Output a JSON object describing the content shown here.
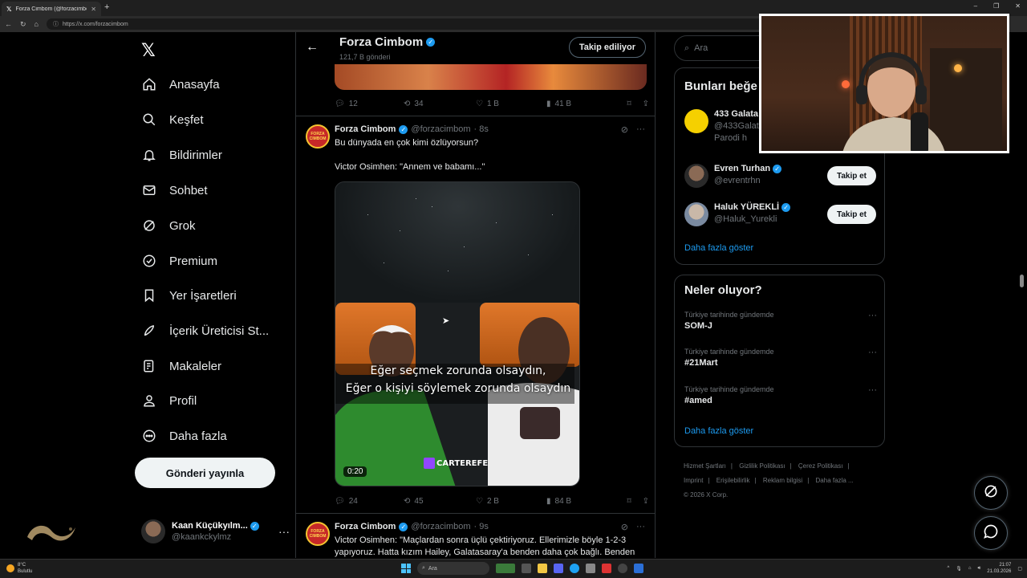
{
  "browser": {
    "tab_title": "Forza Cimbom (@forzacimbom) / X",
    "url": "https://x.com/forzacimbom"
  },
  "nav": {
    "items": [
      {
        "label": "Anasayfa",
        "icon": "home-icon"
      },
      {
        "label": "Keşfet",
        "icon": "search-icon"
      },
      {
        "label": "Bildirimler",
        "icon": "bell-icon"
      },
      {
        "label": "Sohbet",
        "icon": "mail-icon"
      },
      {
        "label": "Grok",
        "icon": "grok-icon"
      },
      {
        "label": "Premium",
        "icon": "premium-icon"
      },
      {
        "label": "Yer İşaretleri",
        "icon": "bookmark-icon"
      },
      {
        "label": "İçerik Üreticisi St...",
        "icon": "rocket-icon"
      },
      {
        "label": "Makaleler",
        "icon": "article-icon"
      },
      {
        "label": "Profil",
        "icon": "person-icon"
      },
      {
        "label": "Daha fazla",
        "icon": "more-circle-icon"
      }
    ],
    "post_button": "Gönderi yayınla",
    "account": {
      "name": "Kaan Küçükyılm...",
      "handle": "@kaankckylmz"
    }
  },
  "profile_header": {
    "name": "Forza Cimbom",
    "post_count": "121,7 B gönderi",
    "follow_label": "Takip ediliyor"
  },
  "prev_tweet_actions": {
    "replies": "12",
    "reposts": "34",
    "likes": "1 B",
    "views": "41 B"
  },
  "tweet1": {
    "name": "Forza Cimbom",
    "handle": "@forzacimbom",
    "time": "· 8s",
    "line1": "Bu dünyada en çok kimi özlüyorsun?",
    "line2": "Victor Osimhen: \"Annem ve babamı...\"",
    "video": {
      "subtitle1": "Eğer seçmek zorunda olsaydın,",
      "subtitle2": "Eğer o kişiyi söylemek zorunda olsaydın",
      "watermark": "CARTEREFE",
      "time": "0:20"
    },
    "actions": {
      "replies": "24",
      "reposts": "45",
      "likes": "2 B",
      "views": "84 B"
    }
  },
  "tweet2": {
    "name": "Forza Cimbom",
    "handle": "@forzacimbom",
    "time": "· 9s",
    "text": "Victor Osimhen: \"Maçlardan sonra üçlü çektiriyoruz. Ellerimizle böyle 1-2-3 yapıyoruz. Hatta kızım Hailey, Galatasaray'a benden daha çok bağlı. Benden"
  },
  "right": {
    "search_placeholder": "Ara",
    "suggest_title": "Bunları beğe",
    "suggestions": [
      {
        "name": "433 Galata",
        "handle": "@433Galat",
        "extra": "Parodi h"
      },
      {
        "name": "Evren Turhan",
        "handle": "@evrentrhn",
        "button": "Takip et"
      },
      {
        "name": "Haluk YÜREKLİ",
        "handle": "@Haluk_Yurekli",
        "button": "Takip et"
      }
    ],
    "suggest_more": "Daha fazla göster",
    "trends_title": "Neler oluyor?",
    "trends": [
      {
        "context": "Türkiye tarihinde gündemde",
        "name": "SOM-J"
      },
      {
        "context": "Türkiye tarihinde gündemde",
        "name": "#21Mart"
      },
      {
        "context": "Türkiye tarihinde gündemde",
        "name": "#amed"
      }
    ],
    "trends_more": "Daha fazla göster",
    "footer": [
      "Hizmet Şartları",
      "|",
      "Gizlilik Politikası",
      "|",
      "Çerez Politikası",
      "|",
      "Imprint",
      "|",
      "Erişilebilirlik",
      "|",
      "Reklam bilgisi",
      "|",
      "Daha fazla ...",
      "© 2026 X Corp."
    ]
  },
  "taskbar": {
    "weather_temp": "8°C",
    "weather_desc": "Bulutlu",
    "search": "Ara",
    "time": "21:07",
    "date": "21.03.2026"
  },
  "colors": {
    "accent": "#1d9bf0",
    "bg": "#000000",
    "border": "#2f3336",
    "muted": "#71767b"
  }
}
